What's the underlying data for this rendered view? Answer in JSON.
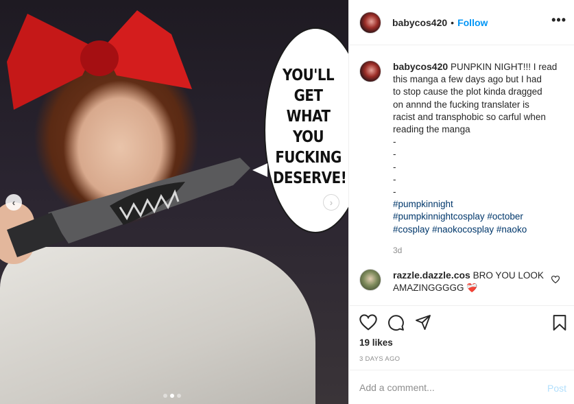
{
  "post": {
    "speech_bubble": [
      "YOU'LL",
      "GET",
      "WHAT",
      "YOU",
      "FUCKING",
      "DESERVE!"
    ],
    "carousel": {
      "prev_icon": "chevron-left-icon",
      "next_icon": "chevron-right-icon",
      "dots": 3,
      "active_dot": 2
    }
  },
  "header": {
    "username": "babycos420",
    "separator": "•",
    "follow_label": "Follow",
    "more_icon": "more-options-icon",
    "more_label": "•••"
  },
  "caption": {
    "username": "babycos420",
    "lines": [
      "PUNPKIN NIGHT!!! I read",
      "this manga a few days ago but I had",
      "to stop cause the plot kinda dragged",
      "on annnd the fucking translater is",
      "racist and transphobic so carful when",
      "reading the manga",
      "-",
      "-",
      "-",
      "-",
      "-"
    ],
    "hashtag_lines": [
      [
        "#pumpkinnight"
      ],
      [
        "#pumpkinnightcosplay",
        "#october"
      ],
      [
        "#cosplay",
        "#naokocosplay",
        "#naoko"
      ]
    ],
    "time": "3d"
  },
  "comment": {
    "username": "razzle.dazzle.cos",
    "text": "BRO YOU LOOK AMAZINGGGGG",
    "emoji": "❤️‍🩹",
    "like_icon": "heart-outline-icon"
  },
  "actions": {
    "like_icon": "heart-icon",
    "comment_icon": "comment-icon",
    "share_icon": "paper-plane-icon",
    "save_icon": "bookmark-icon",
    "likes": "19 likes",
    "date": "3 DAYS AGO"
  },
  "add_comment": {
    "placeholder": "Add a comment...",
    "post_label": "Post"
  },
  "colors": {
    "link_blue": "#0095f6",
    "hashtag": "#00376b",
    "muted": "#8e8e8e",
    "post_disabled": "#b2dffc"
  }
}
